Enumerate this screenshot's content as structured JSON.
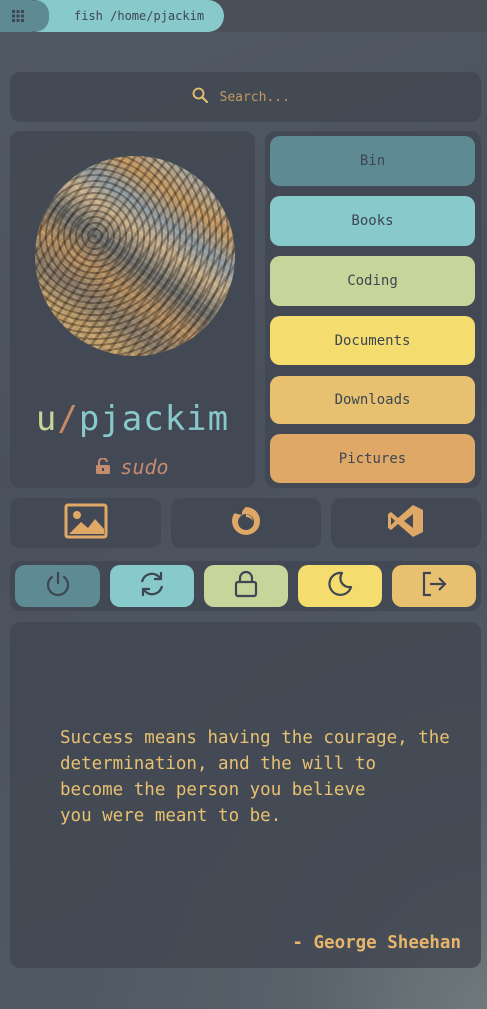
{
  "topbar": {
    "workspace_icon": "grid-icon",
    "window_title": "fish /home/pjackim"
  },
  "search": {
    "placeholder": "Search...",
    "icon": "search-icon"
  },
  "profile": {
    "prefix": "u",
    "separator": "/",
    "username": "pjackim",
    "sudo_label": "sudo",
    "sudo_icon": "unlock-icon"
  },
  "folders": [
    {
      "label": "Bin",
      "color": "#5d8a93"
    },
    {
      "label": "Books",
      "color": "#88c9cc"
    },
    {
      "label": "Coding",
      "color": "#c6d599"
    },
    {
      "label": "Documents",
      "color": "#f4dd6e"
    },
    {
      "label": "Downloads",
      "color": "#e8c170"
    },
    {
      "label": "Pictures",
      "color": "#e0a866"
    }
  ],
  "apps": [
    {
      "name": "image-viewer",
      "icon": "image-icon"
    },
    {
      "name": "firefox",
      "icon": "firefox-icon"
    },
    {
      "name": "vscode",
      "icon": "vscode-icon"
    }
  ],
  "power": [
    {
      "name": "shutdown",
      "icon": "power-icon",
      "color": "#5d8a93"
    },
    {
      "name": "reboot",
      "icon": "refresh-icon",
      "color": "#88c9cc"
    },
    {
      "name": "lock",
      "icon": "lock-icon",
      "color": "#c6d599"
    },
    {
      "name": "sleep",
      "icon": "moon-icon",
      "color": "#f4dd6e"
    },
    {
      "name": "logout",
      "icon": "logout-icon",
      "color": "#e8c170"
    }
  ],
  "quote": {
    "text": "Success means having the courage, the\ndetermination, and the will to\nbecome the person you believe\nyou were meant to be.",
    "author": "- George Sheehan"
  },
  "colors": {
    "accent_orange": "#e8c170",
    "teal": "#88c9cc",
    "dark_teal": "#5d8a93",
    "green": "#c6d599",
    "yellow": "#f4dd6e",
    "peach": "#e0a866",
    "card_bg": "#424852"
  }
}
